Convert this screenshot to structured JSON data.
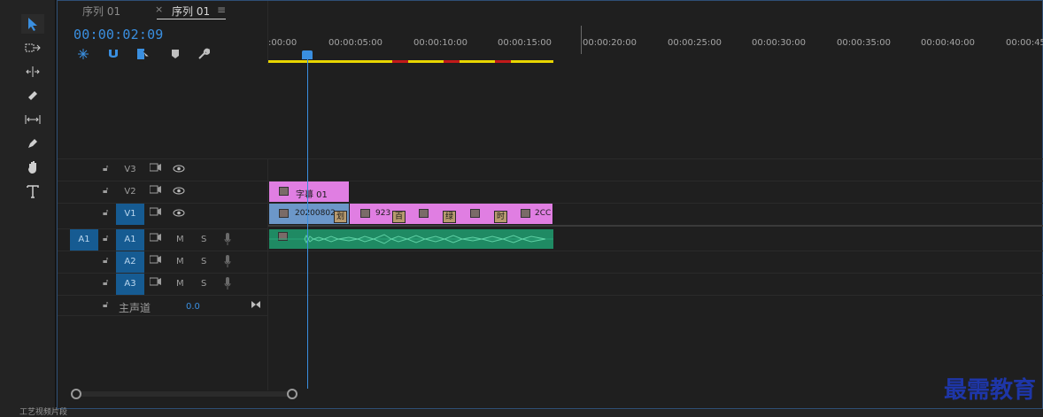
{
  "tabs": [
    {
      "label": "序列 01"
    },
    {
      "close": "×",
      "label": "序列 01",
      "menu": "≡"
    }
  ],
  "timecode": "00:00:02:09",
  "ruler_ticks": [
    ":00:00",
    "00:00:05:00",
    "00:00:10:00",
    "00:00:15:00",
    "00:00:20:00",
    "00:00:25:00",
    "00:00:30:00",
    "00:00:35:00",
    "00:00:40:00",
    "00:00:45"
  ],
  "tracks": {
    "v3": {
      "name": "V3"
    },
    "v2": {
      "name": "V2"
    },
    "v1": {
      "name": "V1"
    },
    "a1": {
      "source": "A1",
      "name": "A1",
      "m": "M",
      "s": "S"
    },
    "a2": {
      "name": "A2",
      "m": "M",
      "s": "S"
    },
    "a3": {
      "name": "A3",
      "m": "M",
      "s": "S"
    },
    "master": {
      "name": "主声道",
      "value": "0.0"
    }
  },
  "clips": {
    "v2_subtitle": "字幕 01",
    "v1_first": "20200802",
    "v1_first_marker": "划",
    "v1_second": "923",
    "v1_markers": [
      "百",
      "绿",
      "时"
    ],
    "v1_end": "2CC"
  },
  "fx_badge": "fx",
  "colors": {
    "accent": "#3a8fe0",
    "clip_pink": "#e07ee2",
    "clip_blue": "#6c97c9",
    "audio_green": "#1f8a63",
    "workbar_yellow": "#e8d500",
    "watermark": "#1e36a8"
  },
  "bottom_text": "工艺视频片段",
  "watermark": "最需教育"
}
